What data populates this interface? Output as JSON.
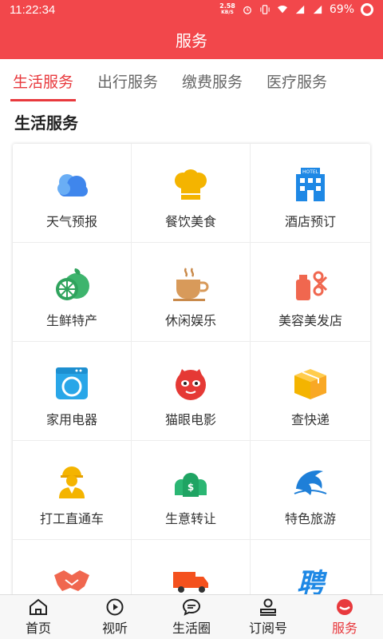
{
  "status_bar": {
    "time": "11:22:34",
    "speed": "2.58",
    "speed_unit": "KB/S",
    "battery": "69%"
  },
  "header": {
    "title": "服务"
  },
  "tabs": [
    {
      "label": "生活服务",
      "active": true
    },
    {
      "label": "出行服务",
      "active": false
    },
    {
      "label": "缴费服务",
      "active": false
    },
    {
      "label": "医疗服务",
      "active": false
    }
  ],
  "section": {
    "title": "生活服务"
  },
  "services": [
    {
      "label": "天气预报",
      "icon": "cloud-icon"
    },
    {
      "label": "餐饮美食",
      "icon": "chef-hat-icon"
    },
    {
      "label": "酒店预订",
      "icon": "hotel-icon",
      "icon_text": "HOTEL"
    },
    {
      "label": "生鲜特产",
      "icon": "fruit-icon"
    },
    {
      "label": "休闲娱乐",
      "icon": "coffee-icon"
    },
    {
      "label": "美容美发店",
      "icon": "scissors-icon"
    },
    {
      "label": "家用电器",
      "icon": "washing-machine-icon"
    },
    {
      "label": "猫眼电影",
      "icon": "cat-eye-icon"
    },
    {
      "label": "查快递",
      "icon": "package-icon"
    },
    {
      "label": "打工直通车",
      "icon": "worker-icon"
    },
    {
      "label": "生意转让",
      "icon": "money-bags-icon",
      "icon_text": "$"
    },
    {
      "label": "特色旅游",
      "icon": "dolphin-icon"
    },
    {
      "label": "",
      "icon": "handshake-icon"
    },
    {
      "label": "",
      "icon": "truck-icon"
    },
    {
      "label": "",
      "icon": "recruit-icon",
      "icon_text": "聘"
    }
  ],
  "bottom_nav": [
    {
      "label": "首页",
      "icon": "home-icon",
      "active": false
    },
    {
      "label": "视听",
      "icon": "play-icon",
      "active": false
    },
    {
      "label": "生活圈",
      "icon": "chat-icon",
      "active": false
    },
    {
      "label": "订阅号",
      "icon": "subscribe-icon",
      "active": false
    },
    {
      "label": "服务",
      "icon": "service-icon",
      "active": true
    }
  ],
  "colors": {
    "brand": "#f2474b",
    "active_text": "#e8393d"
  }
}
